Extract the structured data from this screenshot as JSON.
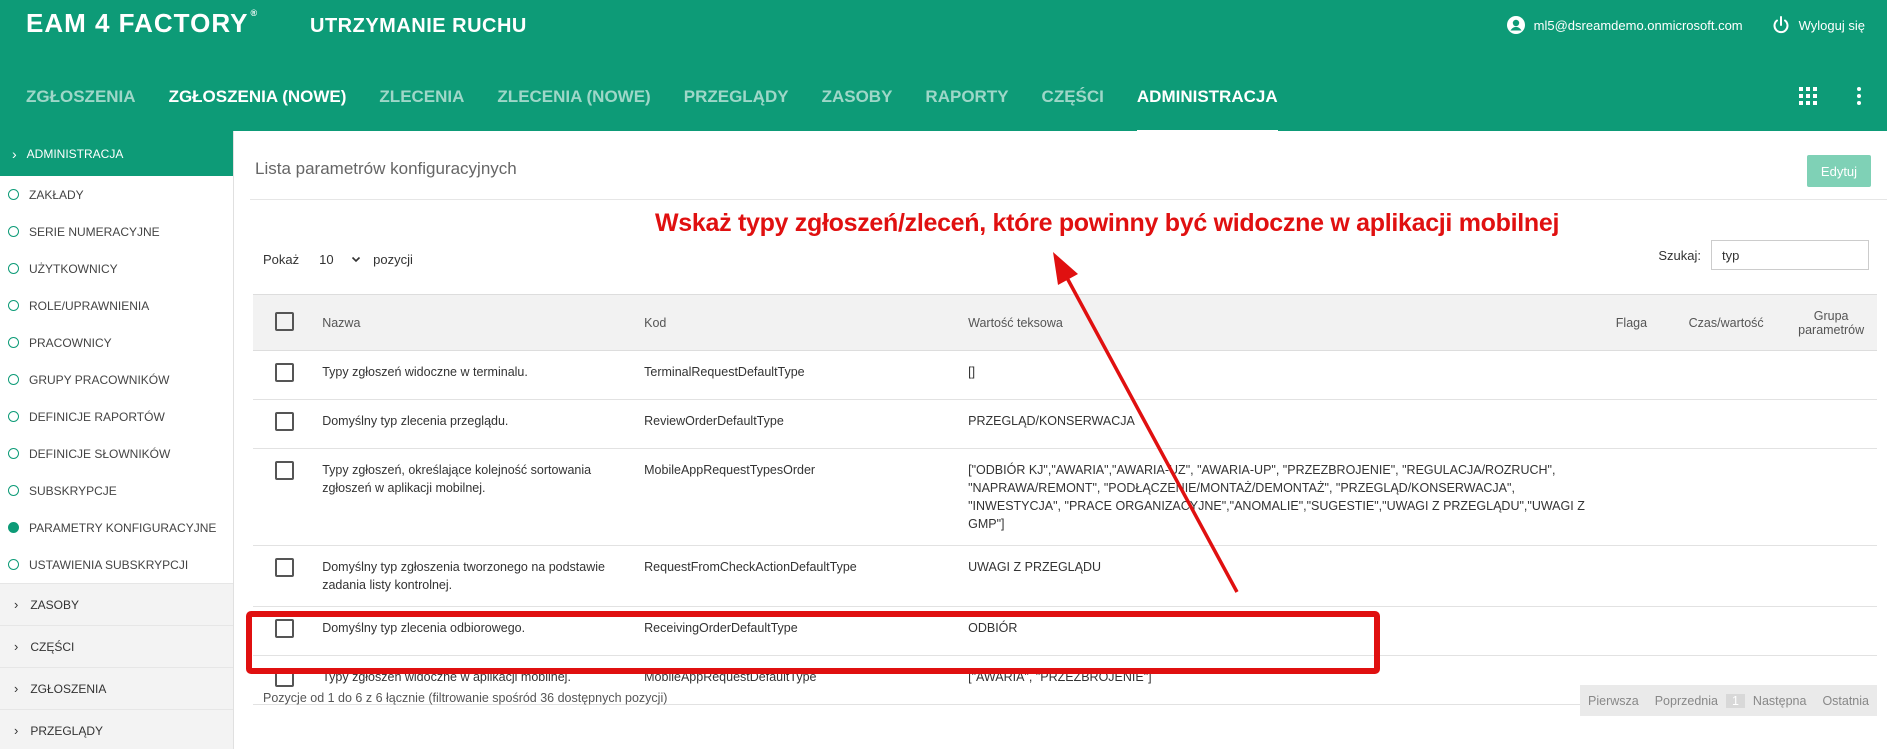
{
  "header": {
    "logo": "EAM 4 FACTORY",
    "logo_reg": "®",
    "app_title": "UTRZYMANIE RUCHU",
    "user_email": "ml5@dsreamdemo.onmicrosoft.com",
    "logout_label": "Wyloguj się"
  },
  "nav": {
    "items": [
      {
        "label": "ZGŁOSZENIA"
      },
      {
        "label": "ZGŁOSZENIA (NOWE)"
      },
      {
        "label": "ZLECENIA"
      },
      {
        "label": "ZLECENIA (NOWE)"
      },
      {
        "label": "PRZEGLĄDY"
      },
      {
        "label": "ZASOBY"
      },
      {
        "label": "RAPORTY"
      },
      {
        "label": "CZĘŚCI"
      },
      {
        "label": "ADMINISTRACJA"
      }
    ]
  },
  "sidebar": {
    "head": "ADMINISTRACJA",
    "sub_items": [
      {
        "label": "ZAKŁADY"
      },
      {
        "label": "SERIE NUMERACYJNE"
      },
      {
        "label": "UŻYTKOWNICY"
      },
      {
        "label": "ROLE/UPRAWNIENIA"
      },
      {
        "label": "PRACOWNICY"
      },
      {
        "label": "GRUPY PRACOWNIKÓW"
      },
      {
        "label": "DEFINICJE RAPORTÓW"
      },
      {
        "label": "DEFINICJE SŁOWNIKÓW"
      },
      {
        "label": "SUBSKRYPCJE"
      },
      {
        "label": "PARAMETRY KONFIGURACYJNE"
      },
      {
        "label": "USTAWIENIA SUBSKRYPCJI"
      }
    ],
    "groups": [
      {
        "label": "ZASOBY"
      },
      {
        "label": "CZĘŚCI"
      },
      {
        "label": "ZGŁOSZENIA"
      },
      {
        "label": "PRZEGLĄDY"
      }
    ]
  },
  "main": {
    "title": "Lista parametrów konfiguracyjnych",
    "edit_label": "Edytuj",
    "show_label": "Pokaż",
    "show_value": "10",
    "show_suffix": "pozycji",
    "search_label": "Szukaj:",
    "search_value": "typ",
    "columns": {
      "name": "Nazwa",
      "code": "Kod",
      "value": "Wartość teksowa",
      "flag": "Flaga",
      "time": "Czas/wartość",
      "group": "Grupa parametrów"
    },
    "rows": [
      {
        "name": "Typy zgłoszeń widoczne w terminalu.",
        "code": "TerminalRequestDefaultType",
        "value": "[]"
      },
      {
        "name": "Domyślny typ zlecenia przeglądu.",
        "code": "ReviewOrderDefaultType",
        "value": "PRZEGLĄD/KONSERWACJA"
      },
      {
        "name": "Typy zgłoszeń, określające kolejność sortowania zgłoszeń w aplikacji mobilnej.",
        "code": "MobileAppRequestTypesOrder",
        "value": "[\"ODBIÓR KJ\",\"AWARIA\",\"AWARIA-UZ\", \"AWARIA-UP\", \"PRZEZBROJENIE\", \"REGULACJA/ROZRUCH\", \"NAPRAWA/REMONT\", \"PODŁĄCZENIE/MONTAŻ/DEMONTAŻ\", \"PRZEGLĄD/KONSERWACJA\", \"INWESTYCJA\", \"PRACE ORGANIZACYJNE\",\"ANOMALIE\",\"SUGESTIE\",\"UWAGI Z PRZEGLĄDU\",\"UWAGI Z GMP\"]"
      },
      {
        "name": "Domyślny typ zgłoszenia tworzonego na podstawie zadania listy kontrolnej.",
        "code": "RequestFromCheckActionDefaultType",
        "value": "UWAGI Z PRZEGLĄDU"
      },
      {
        "name": "Domyślny typ zlecenia odbiorowego.",
        "code": "ReceivingOrderDefaultType",
        "value": "ODBIÓR"
      },
      {
        "name": "Typy zgłoszeń widoczne w aplikacji mobilnej.",
        "code": "MobileAppRequestDefaultType",
        "value": "[\"AWARIA\", \"PRZEZBROJENIE\"]"
      }
    ],
    "footer_info": "Pozycje od 1 do 6 z 6 łącznie (filtrowanie spośród 36 dostępnych pozycji)",
    "pager": {
      "first": "Pierwsza",
      "prev": "Poprzednia",
      "current": "1",
      "next": "Następna",
      "last": "Ostatnia"
    }
  },
  "annotation": {
    "text": "Wskaż typy zgłoszeń/zleceń, które powinny być widoczne w aplikacji mobilnej",
    "color": "#e01010"
  },
  "colors": {
    "brand": "#0d9b77",
    "edit_button": "#7fd1b6"
  }
}
